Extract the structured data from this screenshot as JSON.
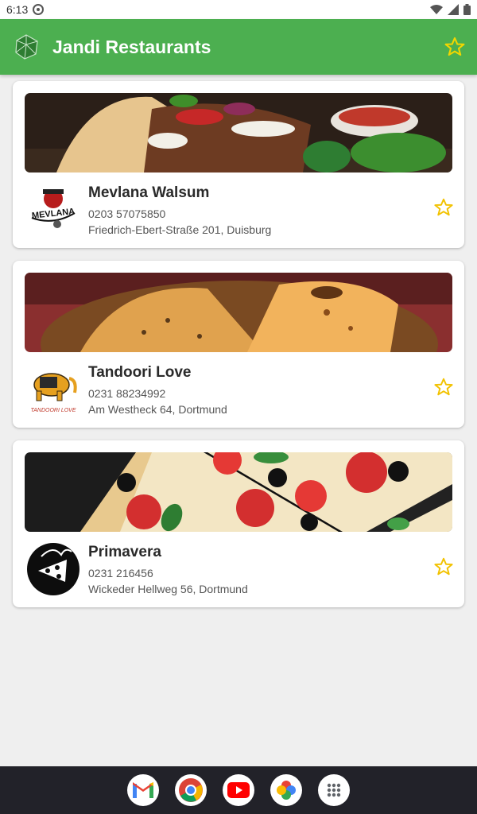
{
  "status_bar": {
    "time": "6:13",
    "icons": [
      "settings-icon",
      "wifi-icon",
      "signal-icon",
      "battery-icon"
    ]
  },
  "app_bar": {
    "title": "Jandi Restaurants",
    "logo": "gem-logo-icon",
    "favorites_icon": "star-outline-icon"
  },
  "colors": {
    "primary": "#4caf50",
    "star": "#f2c200"
  },
  "restaurants": [
    {
      "name": "Mevlana Walsum",
      "phone": "0203 57075850",
      "address": "Friedrich-Ebert-Straße 201, Duisburg",
      "logo_text": "MEVLANA",
      "photo": "doner-kebab-photo"
    },
    {
      "name": "Tandoori Love",
      "phone": "0231 88234992",
      "address": "Am Westheck 64, Dortmund",
      "logo_text": "TANDOORI LOVE",
      "photo": "naan-bread-photo"
    },
    {
      "name": "Primavera",
      "phone": "0231 216456",
      "address": "Wickeder Hellweg 56, Dortmund",
      "logo_text": "",
      "photo": "pizza-photo"
    }
  ],
  "dock_apps": [
    "gmail-icon",
    "chrome-icon",
    "youtube-icon",
    "photos-icon",
    "app-drawer-icon"
  ]
}
